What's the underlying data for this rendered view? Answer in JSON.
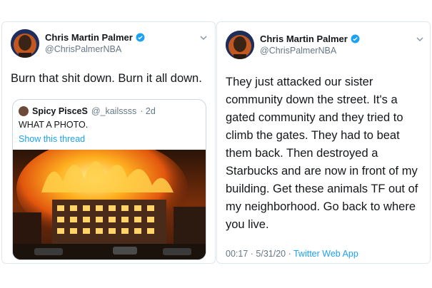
{
  "left_tweet": {
    "author": {
      "name": "Chris Martin Palmer",
      "handle": "@ChrisPalmerNBA"
    },
    "text": "Burn that shit down. Burn it all down.",
    "quoted": {
      "name": "Spicy PisceS",
      "handle": "@_kailssss",
      "time": "· 2d",
      "text": "WHAT A PHOTO.",
      "link": "Show this thread"
    }
  },
  "right_tweet": {
    "author": {
      "name": "Chris Martin Palmer",
      "handle": "@ChrisPalmerNBA"
    },
    "lines": [
      "They just attacked our sister",
      "community down the street. It's a",
      "gated community and they tried to",
      "climb the gates. They had to beat",
      "them back. Then destroyed a",
      "Starbucks and are now in front of my",
      "building. Get these animals TF out of",
      "my neighborhood. Go back to where",
      "you live."
    ],
    "time": "00:17 · 5/31/20 · ",
    "app": "Twitter Web App"
  },
  "colors": {
    "verified": "#1da1f2",
    "link": "#1da1f2",
    "secondary": "#657786"
  },
  "icons": [
    "avatar",
    "verified-badge-icon",
    "chevron-down-icon"
  ]
}
